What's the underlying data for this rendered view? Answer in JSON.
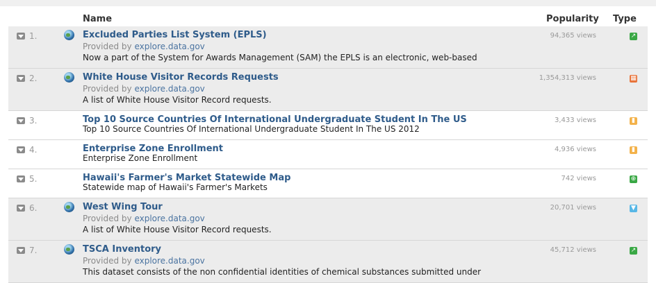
{
  "header": {
    "name": "Name",
    "popularity": "Popularity",
    "type": "Type"
  },
  "colors": {
    "link": "#2e5b8a",
    "green": "#3aa845",
    "orange": "#e8743b",
    "lightorange": "#f3b24a",
    "blue": "#58b7e6"
  },
  "rows": [
    {
      "number": "1.",
      "title": "Excluded Parties List System (EPLS)",
      "provided_prefix": "Provided by ",
      "provider": "explore.data.gov",
      "description": "Now a part of the System for Awards Management (SAM) the EPLS is an electronic, web-based",
      "views": "94,365 views",
      "type_icon": "external-link-icon"
    },
    {
      "number": "2.",
      "title": "White House Visitor Records Requests",
      "provided_prefix": "Provided by ",
      "provider": "explore.data.gov",
      "description": "A list of White House Visitor Record requests.",
      "views": "1,354,313 views",
      "type_icon": "table-icon"
    },
    {
      "number": "3.",
      "title": "Top 10 Source Countries Of International Undergraduate Student In The US",
      "description": "Top 10 Source Countries Of International Undergraduate Student In The US 2012",
      "views": "3,433 views",
      "type_icon": "bar-chart-icon"
    },
    {
      "number": "4.",
      "title": "Enterprise Zone Enrollment",
      "description": "Enterprise Zone Enrollment",
      "views": "4,936 views",
      "type_icon": "bar-chart-icon"
    },
    {
      "number": "5.",
      "title": "Hawaii's Farmer's Market Statewide Map",
      "description": "Statewide map of Hawaii's Farmer's Markets",
      "views": "742 views",
      "type_icon": "map-icon"
    },
    {
      "number": "6.",
      "title": "West Wing Tour",
      "provided_prefix": "Provided by ",
      "provider": "explore.data.gov",
      "description": "A list of White House Visitor Record requests.",
      "views": "20,701 views",
      "type_icon": "filter-icon"
    },
    {
      "number": "7.",
      "title": "TSCA Inventory",
      "provided_prefix": "Provided by ",
      "provider": "explore.data.gov",
      "description": "This dataset consists of the non confidential identities of chemical substances submitted under",
      "views": "45,712 views",
      "type_icon": "external-link-icon"
    }
  ]
}
